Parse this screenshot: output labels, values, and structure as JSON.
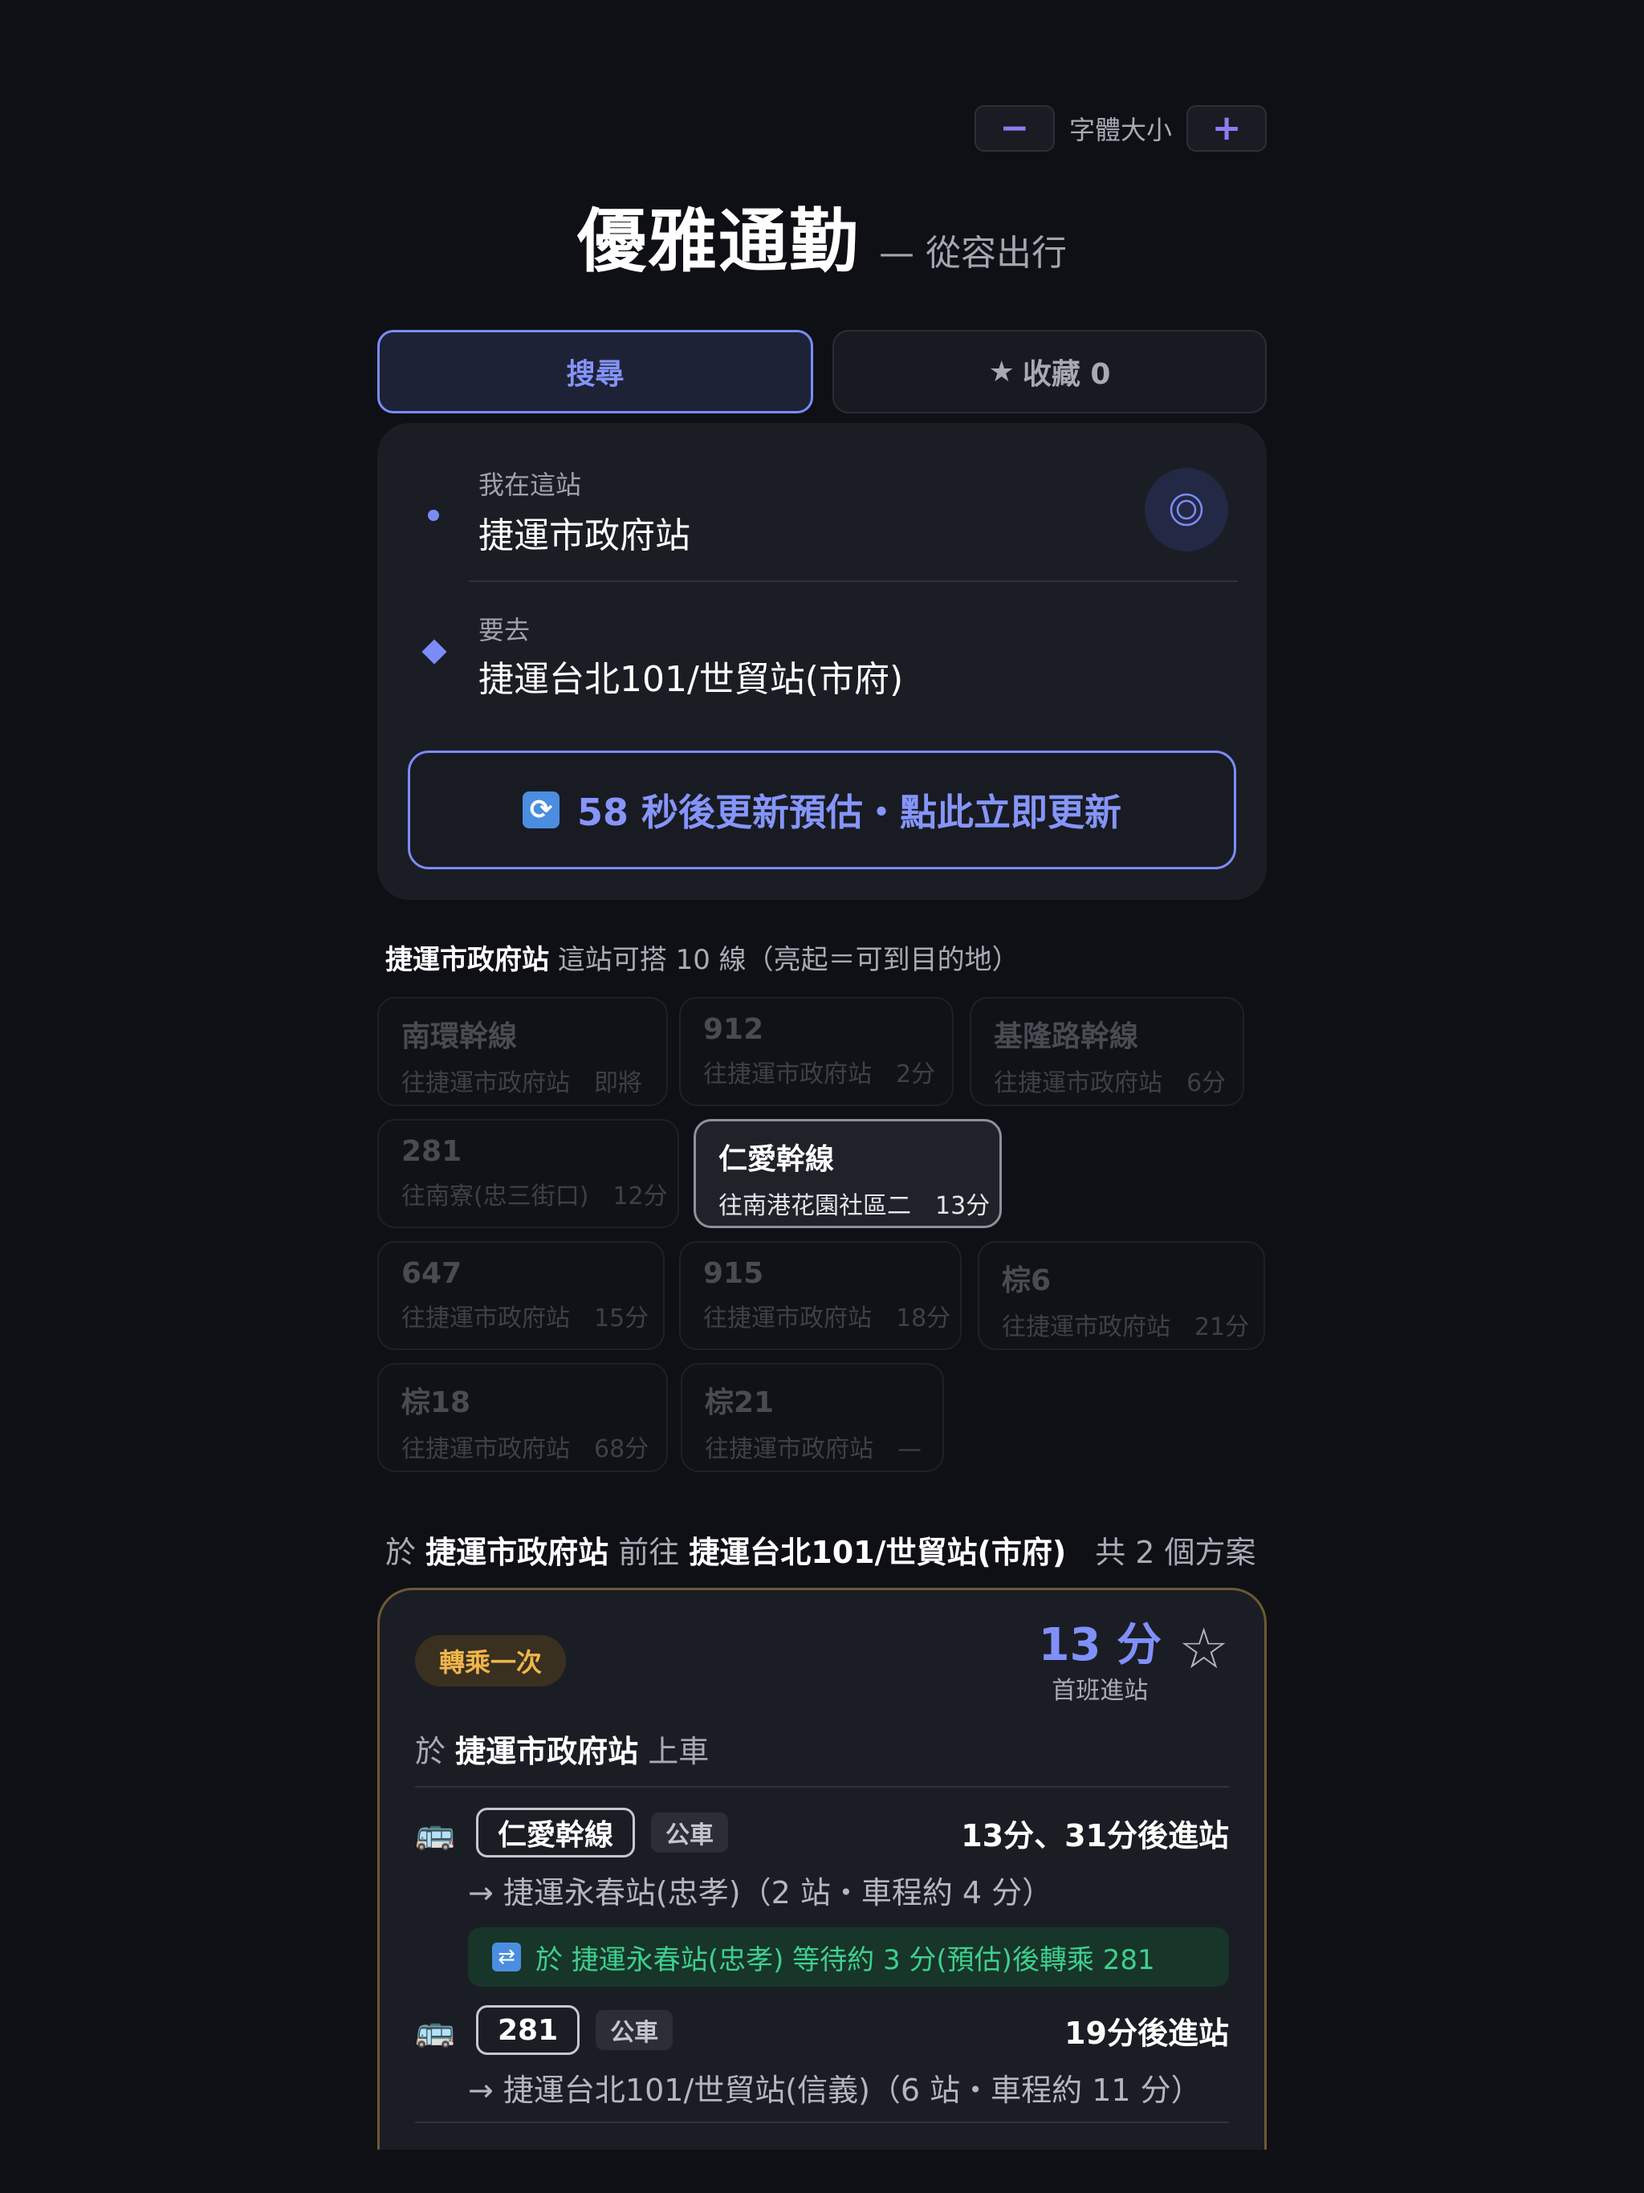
{
  "font_control": {
    "minus": "−",
    "label": "字體大小",
    "plus": "+"
  },
  "title": {
    "main": "優雅通勤",
    "sub": "— 從容出行"
  },
  "tabs": [
    {
      "label": "搜尋",
      "active": true
    },
    {
      "icon": "★",
      "label": "收藏 0",
      "active": false
    }
  ],
  "search": {
    "from_label": "我在這站",
    "from_value": "捷運市政府站",
    "to_label": "要去",
    "to_value": "捷運台北101/世貿站(市府)",
    "locate_icon": "◎",
    "refresh_icon": "🔄",
    "refresh_text": "58 秒後更新預估・點此立即更新"
  },
  "station_lines": {
    "station": "捷運市政府站",
    "summary": " 這站可搭 10 線（亮起＝可到目的地）",
    "routes": [
      {
        "name": "南環幹線",
        "dest": "往捷運市政府站",
        "time": "即將",
        "lit": false
      },
      {
        "name": "912",
        "dest": "往捷運市政府站",
        "time": "2分",
        "lit": false
      },
      {
        "name": "基隆路幹線",
        "dest": "往捷運市政府站",
        "time": "6分",
        "lit": false
      },
      {
        "name": "281",
        "dest": "往南寮(忠三街口)",
        "time": "12分",
        "lit": false
      },
      {
        "name": "仁愛幹線",
        "dest": "往南港花園社區二",
        "time": "13分",
        "lit": true
      },
      {
        "name": "647",
        "dest": "往捷運市政府站",
        "time": "15分",
        "lit": false
      },
      {
        "name": "915",
        "dest": "往捷運市政府站",
        "time": "18分",
        "lit": false
      },
      {
        "name": "棕6",
        "dest": "往捷運市政府站",
        "time": "21分",
        "lit": false
      },
      {
        "name": "棕18",
        "dest": "往捷運市政府站",
        "time": "68分",
        "lit": false
      },
      {
        "name": "棕21",
        "dest": "往捷運市政府站",
        "time": "—",
        "lit": false
      }
    ]
  },
  "plans_header": {
    "p1": "於 ",
    "from": "捷運市政府站",
    "p2": " 前往 ",
    "to": "捷運台北101/世貿站(市府)",
    "count": "共 2 個方案"
  },
  "plan": {
    "badge": "轉乘一次",
    "eta_num": "13 分",
    "eta_sub": "首班進站",
    "star": "☆",
    "board_p1": "於 ",
    "board_station": "捷運市政府站",
    "board_p2": " 上車",
    "legs": [
      {
        "icon": "🚌",
        "route": "仁愛幹線",
        "mode": "公車",
        "arrivals": "13分、31分後進站",
        "dest": "→ 捷運永春站(忠孝)（2 站・車程約 4 分）"
      },
      {
        "icon": "🚌",
        "route": "281",
        "mode": "公車",
        "arrivals": "19分後進站",
        "dest": "→ 捷運台北101/世貿站(信義)（6 站・車程約 11 分）"
      }
    ],
    "transfer_icon": "🔁",
    "transfer_text": "於 捷運永春站(忠孝) 等待約 3 分(預估)後轉乘 281"
  },
  "colors": {
    "background": "#0f1015",
    "accent": "#7b8cf8",
    "transfer_green": "#3ecf8e",
    "badge_orange": "#f0b54a",
    "plan_border": "#6d5a32"
  }
}
